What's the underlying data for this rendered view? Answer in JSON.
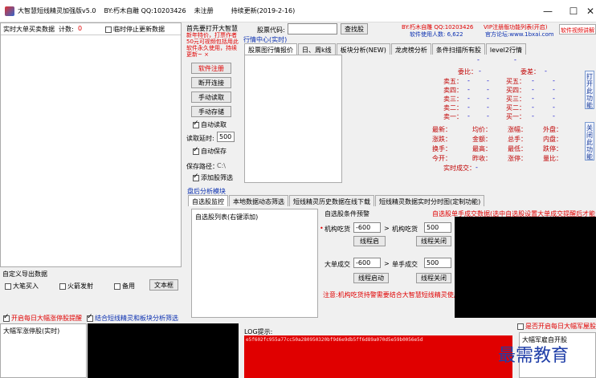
{
  "window": {
    "title": "大智慧短线精灵加强版v5.0",
    "author": "BY:朽木自雕 QQ:10203426",
    "reg_status": "未注册",
    "update": "持续更新(2019-2-16)",
    "min": "—",
    "max": "☐",
    "close": "✕"
  },
  "left_panel": {
    "header": "实时大单买卖数据",
    "count_label": "计数:",
    "count_value": "0",
    "pause_label": "临时停止更新数据"
  },
  "custom_export": {
    "title": "自定义导出数据",
    "options": [
      "大笔买入",
      "火箭发射",
      "备用"
    ],
    "text_btn": "文本框"
  },
  "bottom_checks": {
    "monitor_label": "开启每日大幅涨停股提醒",
    "combine_label": "结合短线精灵和板块分析筛选",
    "daily_top_label": "是否开启每日大幅军屋股"
  },
  "limit_up": {
    "title": "大幅军涨停股(实时)"
  },
  "controls": {
    "notice_title": "首先要打开大智慧",
    "promo": "新年特价，打票作者50元可视频包括用此软件永久使用，持续更新~ ×",
    "buttons": [
      "软件注册",
      "断开连接",
      "手动读取",
      "手动存储"
    ],
    "auto_read": "自动读取",
    "read_delay_label": "读取延时:",
    "read_delay_value": "500",
    "auto_save": "自动保存",
    "save_path_label": "保存路径：",
    "save_path_value": "C:\\",
    "add_filter": "添加股筛选"
  },
  "stock_search": {
    "code_label": "股票代码:",
    "search_btn": "查找股",
    "author_info": "BY:朽木自雕 QQ:10203426",
    "users": "软件使用人数: 6,622",
    "vip": "VIP注册版功能列表(开启)",
    "forum": "官方论坛:www.1bxai.com",
    "video": "软件视频讲解"
  },
  "info_center": {
    "title": "行情中心(实时)",
    "tabs": [
      "股票图行情报价",
      "日、周k线",
      "板块分析(NEW)",
      "龙虎榜分析",
      "条件扫描所有股",
      "level2行情"
    ]
  },
  "quote": {
    "dash": "-",
    "wei_bi": "委比：",
    "wei_cha": "委差：",
    "sell": [
      "卖五：",
      "卖四：",
      "卖三：",
      "卖二：",
      "卖一："
    ],
    "buy": [
      "买五：",
      "买四：",
      "买三：",
      "买二：",
      "买一："
    ],
    "stats_left": [
      "最新：",
      "涨跌：",
      "换手：",
      "今开："
    ],
    "stats_mid": [
      "均价：",
      "金额：",
      "最高：",
      "昨收："
    ],
    "stats_right1": [
      "涨幅：",
      "总手：",
      "最低：",
      "涨停："
    ],
    "stats_right2": [
      "外盘：",
      "内盘：",
      "跌停：",
      "量比："
    ],
    "real_trade": "实时成交：",
    "side_btn1": "打开此功能",
    "side_btn2": "关闭此功能"
  },
  "analysis": {
    "title": "盘后分析模块",
    "tabs": [
      "自选股监控",
      "本地数据动态筛选",
      "短线精灵历史数据在线下载",
      "短线精灵数据实时分时图(定制功能)"
    ],
    "watchlist": "自选股列表(右键添加)",
    "cond_title": "自选股条件预警",
    "cond_red": "自选股单手成交数据(选中自选股设置大单成交提醒后才能",
    "inst_buy": "机构吃货",
    "inst_val1": "-600",
    "arrow": ">",
    "inst_sell": "机构吃货",
    "inst_val2": "500",
    "start_btn1": "线程启",
    "close_btn1": "线程关闭",
    "big_trade": "大单成交",
    "big_val1": "-600",
    "single_trade": "单手成交",
    "big_val2": "500",
    "start_btn2": "线程启动",
    "close_btn2": "线程关闭",
    "note": "注意:机构吃货持警需要结合大智慧短线精灵使用"
  },
  "log": {
    "title": "LOG提示:",
    "line": "e5f602fc955a77cc50a280950320bf9d6e9db5ff6d89a070d5e59b0056e5d"
  },
  "watermark": {
    "text": "最需教育",
    "partial": "大幅军雇自开股"
  },
  "colors": {
    "accent_red": "#e00000",
    "accent_blue": "#0a2fb0",
    "panel_black": "#000000"
  }
}
